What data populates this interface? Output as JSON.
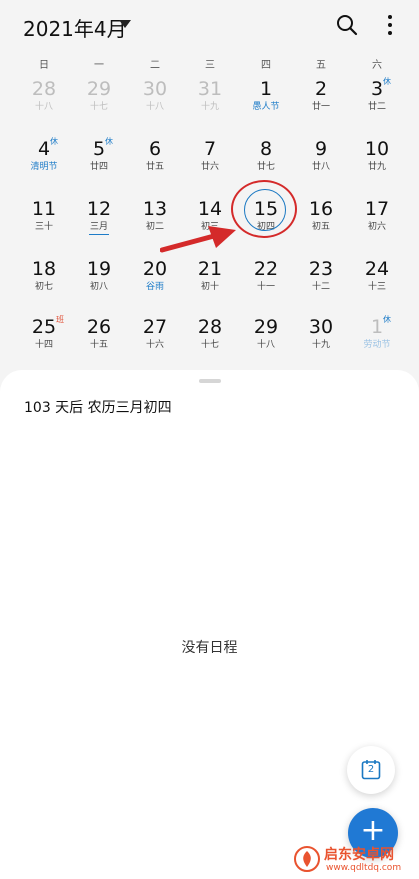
{
  "header": {
    "month_title": "2021年4月",
    "search_icon": "search-icon",
    "more_icon": "more-vertical-icon"
  },
  "weekdays": [
    "日",
    "一",
    "二",
    "三",
    "四",
    "五",
    "六"
  ],
  "weeks": [
    [
      {
        "num": "28",
        "lun": "十八",
        "other": true
      },
      {
        "num": "29",
        "lun": "十七",
        "other": true
      },
      {
        "num": "30",
        "lun": "十八",
        "other": true
      },
      {
        "num": "31",
        "lun": "十九",
        "other": true
      },
      {
        "num": "1",
        "lun": "愚人节",
        "hl": true
      },
      {
        "num": "2",
        "lun": "廿一"
      },
      {
        "num": "3",
        "lun": "廿二",
        "badge": "休"
      }
    ],
    [
      {
        "num": "4",
        "lun": "清明节",
        "hl": true,
        "badge": "休"
      },
      {
        "num": "5",
        "lun": "廿四",
        "badge": "休"
      },
      {
        "num": "6",
        "lun": "廿五"
      },
      {
        "num": "7",
        "lun": "廿六"
      },
      {
        "num": "8",
        "lun": "廿七"
      },
      {
        "num": "9",
        "lun": "廿八"
      },
      {
        "num": "10",
        "lun": "廿九"
      }
    ],
    [
      {
        "num": "11",
        "lun": "三十"
      },
      {
        "num": "12",
        "lun": "三月",
        "underline": true
      },
      {
        "num": "13",
        "lun": "初二"
      },
      {
        "num": "14",
        "lun": "初三"
      },
      {
        "num": "15",
        "lun": "初四",
        "today": true
      },
      {
        "num": "16",
        "lun": "初五"
      },
      {
        "num": "17",
        "lun": "初六"
      }
    ],
    [
      {
        "num": "18",
        "lun": "初七"
      },
      {
        "num": "19",
        "lun": "初八"
      },
      {
        "num": "20",
        "lun": "谷雨",
        "hl": true
      },
      {
        "num": "21",
        "lun": "初十"
      },
      {
        "num": "22",
        "lun": "十一"
      },
      {
        "num": "23",
        "lun": "十二"
      },
      {
        "num": "24",
        "lun": "十三"
      }
    ],
    [
      {
        "num": "25",
        "lun": "十四",
        "badge": "班",
        "work": true
      },
      {
        "num": "26",
        "lun": "十五"
      },
      {
        "num": "27",
        "lun": "十六"
      },
      {
        "num": "28",
        "lun": "十七"
      },
      {
        "num": "29",
        "lun": "十八"
      },
      {
        "num": "30",
        "lun": "十九"
      },
      {
        "num": "1",
        "lun": "劳动节",
        "hl": true,
        "other": true,
        "badge": "休"
      }
    ]
  ],
  "info": "103 天后 农历三月初四",
  "empty_text": "没有日程",
  "fab_today_label": "2",
  "fab_add_label": "+",
  "watermark": {
    "line1": "启东安卓网",
    "line2": "www.qdltdq.com"
  },
  "colors": {
    "accent": "#1e7cc8",
    "annotation": "#d42a2a",
    "fab": "#2079d4"
  }
}
